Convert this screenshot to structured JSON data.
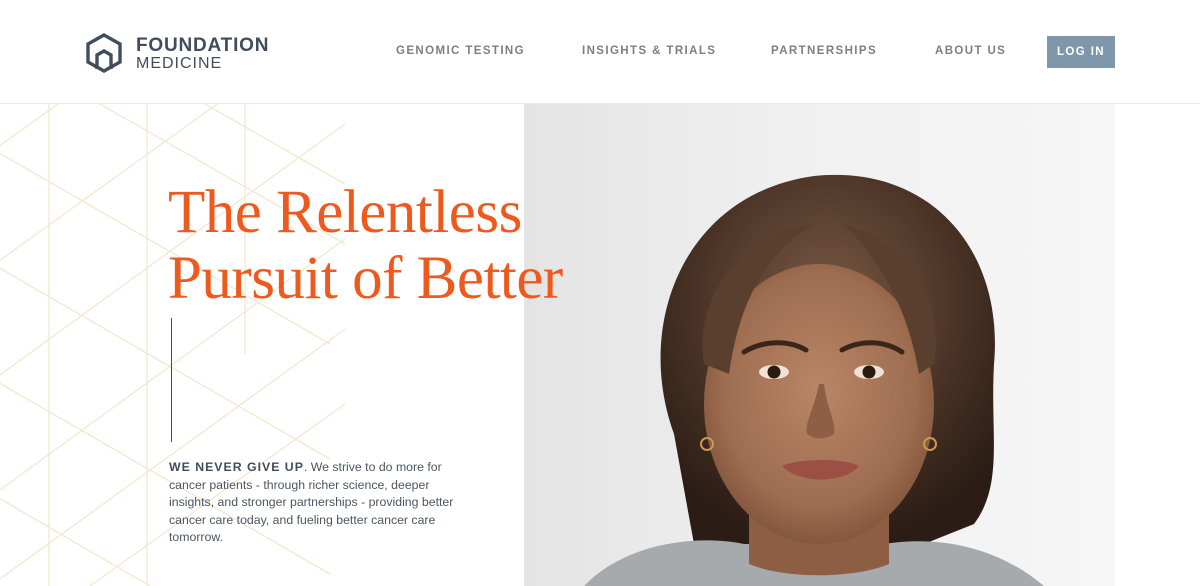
{
  "brand": {
    "name_line1": "FOUNDATION",
    "name_line2": "MEDICINE",
    "logo_icon": "hexagon-logo-icon",
    "colors": {
      "navy": "#3f4d5c",
      "accent_orange": "#ee5a1e",
      "login_button": "#7e97aa",
      "nav_text": "#7c7f82"
    }
  },
  "nav": {
    "items": [
      {
        "label": "GENOMIC TESTING"
      },
      {
        "label": "INSIGHTS & TRIALS"
      },
      {
        "label": "PARTNERSHIPS"
      },
      {
        "label": "ABOUT US"
      }
    ],
    "login_label": "LOG IN"
  },
  "hero": {
    "headline_line1": "The Relentless",
    "headline_line2": "Pursuit of Better",
    "intro_lead": "WE NEVER GIVE UP",
    "intro_body": ". We strive to do more for cancer patients - through richer science, deeper insights, and stronger partnerships - providing better cancer care today, and fueling better cancer care tomorrow.",
    "image_subject": "portrait-photo"
  }
}
